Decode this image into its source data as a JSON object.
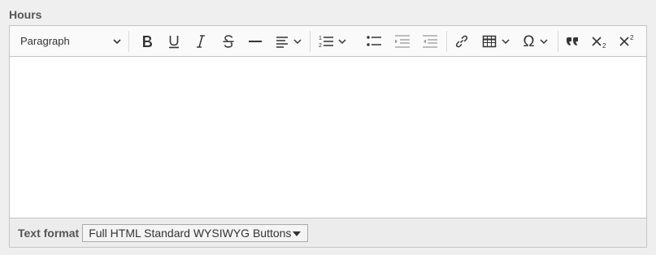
{
  "field": {
    "label": "Hours"
  },
  "toolbar": {
    "heading_value": "Paragraph",
    "buttons": [
      {
        "name": "bold",
        "icon": "bold-icon"
      },
      {
        "name": "underline",
        "icon": "underline-icon"
      },
      {
        "name": "italic",
        "icon": "italic-icon"
      },
      {
        "name": "strikethrough",
        "icon": "strikethrough-icon"
      },
      {
        "name": "horizontal-line",
        "icon": "horizontal-line-icon"
      },
      {
        "name": "text-alignment",
        "icon": "align-left-icon"
      },
      {
        "name": "numbered-list",
        "icon": "numbered-list-icon"
      },
      {
        "name": "bulleted-list",
        "icon": "bulleted-list-icon"
      },
      {
        "name": "outdent",
        "icon": "outdent-icon"
      },
      {
        "name": "indent",
        "icon": "indent-icon"
      },
      {
        "name": "link",
        "icon": "link-icon"
      },
      {
        "name": "insert-table",
        "icon": "table-icon"
      },
      {
        "name": "special-characters",
        "icon": "omega-icon"
      },
      {
        "name": "block-quote",
        "icon": "quote-icon"
      },
      {
        "name": "subscript",
        "icon": "subscript-icon"
      },
      {
        "name": "superscript",
        "icon": "superscript-icon"
      }
    ]
  },
  "format": {
    "label": "Text format",
    "selected": "Full HTML Standard WYSIWYG Buttons"
  }
}
